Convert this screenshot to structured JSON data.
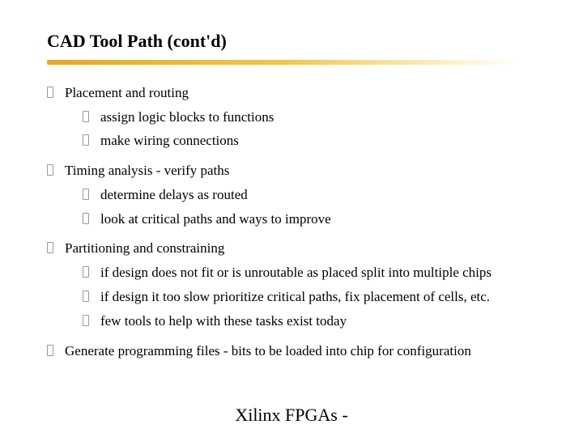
{
  "title": "CAD Tool Path (cont'd)",
  "bullets": {
    "b1": "Placement and routing",
    "b1_1": "assign logic blocks to functions",
    "b1_2": "make wiring connections",
    "b2": "Timing analysis - verify paths",
    "b2_1": "determine delays as routed",
    "b2_2": "look at critical paths and ways to improve",
    "b3": "Partitioning and constraining",
    "b3_1": "if design does not fit or is unroutable as placed split into multiple chips",
    "b3_2": "if design it too slow prioritize critical paths, fix placement of cells, etc.",
    "b3_3": "few tools to help with these tasks exist today",
    "b4": "Generate programming files - bits to be loaded into chip for configuration"
  },
  "footer": "Xilinx FPGAs -"
}
